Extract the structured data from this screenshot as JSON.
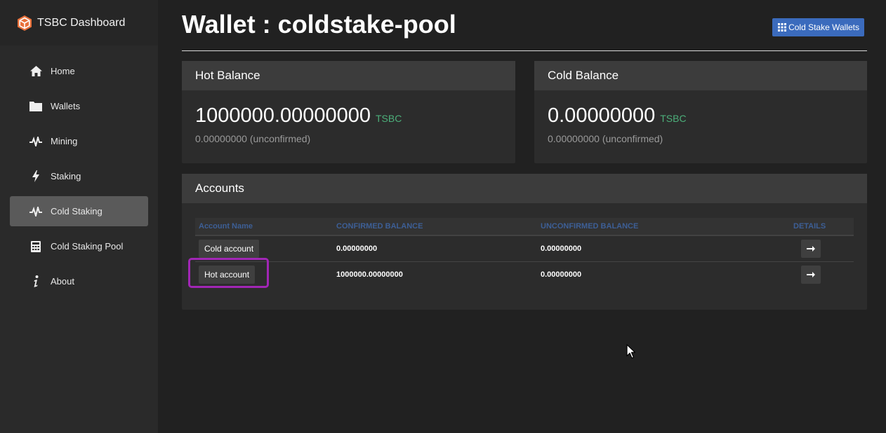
{
  "sidebar": {
    "brand": {
      "title": "TSBC Dashboard",
      "icon": "tsbc-logo-icon"
    },
    "items": [
      {
        "label": "Home",
        "icon": "home-icon",
        "active": false
      },
      {
        "label": "Wallets",
        "icon": "folder-icon",
        "active": false
      },
      {
        "label": "Mining",
        "icon": "pulse-icon",
        "active": false
      },
      {
        "label": "Staking",
        "icon": "bolt-icon",
        "active": false
      },
      {
        "label": "Cold Staking",
        "icon": "pulse-icon",
        "active": true
      },
      {
        "label": "Cold Staking Pool",
        "icon": "calculator-icon",
        "active": false
      },
      {
        "label": "About",
        "icon": "info-icon",
        "active": false
      }
    ]
  },
  "header": {
    "title": "Wallet : coldstake-pool",
    "button_label": "Cold Stake Wallets",
    "button_icon": "grid-icon"
  },
  "hot_balance": {
    "title": "Hot Balance",
    "value": "1000000.00000000",
    "unit": "TSBC",
    "unconfirmed": "0.00000000 (unconfirmed)"
  },
  "cold_balance": {
    "title": "Cold Balance",
    "value": "0.00000000",
    "unit": "TSBC",
    "unconfirmed": "0.00000000 (unconfirmed)"
  },
  "accounts": {
    "title": "Accounts",
    "columns": [
      "Account Name",
      "CONFIRMED BALANCE",
      "UNCONFIRMED BALANCE",
      "DETAILS"
    ],
    "rows": [
      {
        "name": "Cold account",
        "confirmed": "0.00000000",
        "unconfirmed": "0.00000000",
        "details_icon": "arrow-right-icon"
      },
      {
        "name": "Hot account",
        "confirmed": "1000000.00000000",
        "unconfirmed": "0.00000000",
        "details_icon": "arrow-right-icon"
      }
    ]
  },
  "colors": {
    "background": "#212121",
    "sidebar": "#2a2a2a",
    "accent_button": "#3b6bbd",
    "currency": "#4caf7a",
    "table_header_text": "#3d5f96",
    "highlight": "#a126b5"
  }
}
